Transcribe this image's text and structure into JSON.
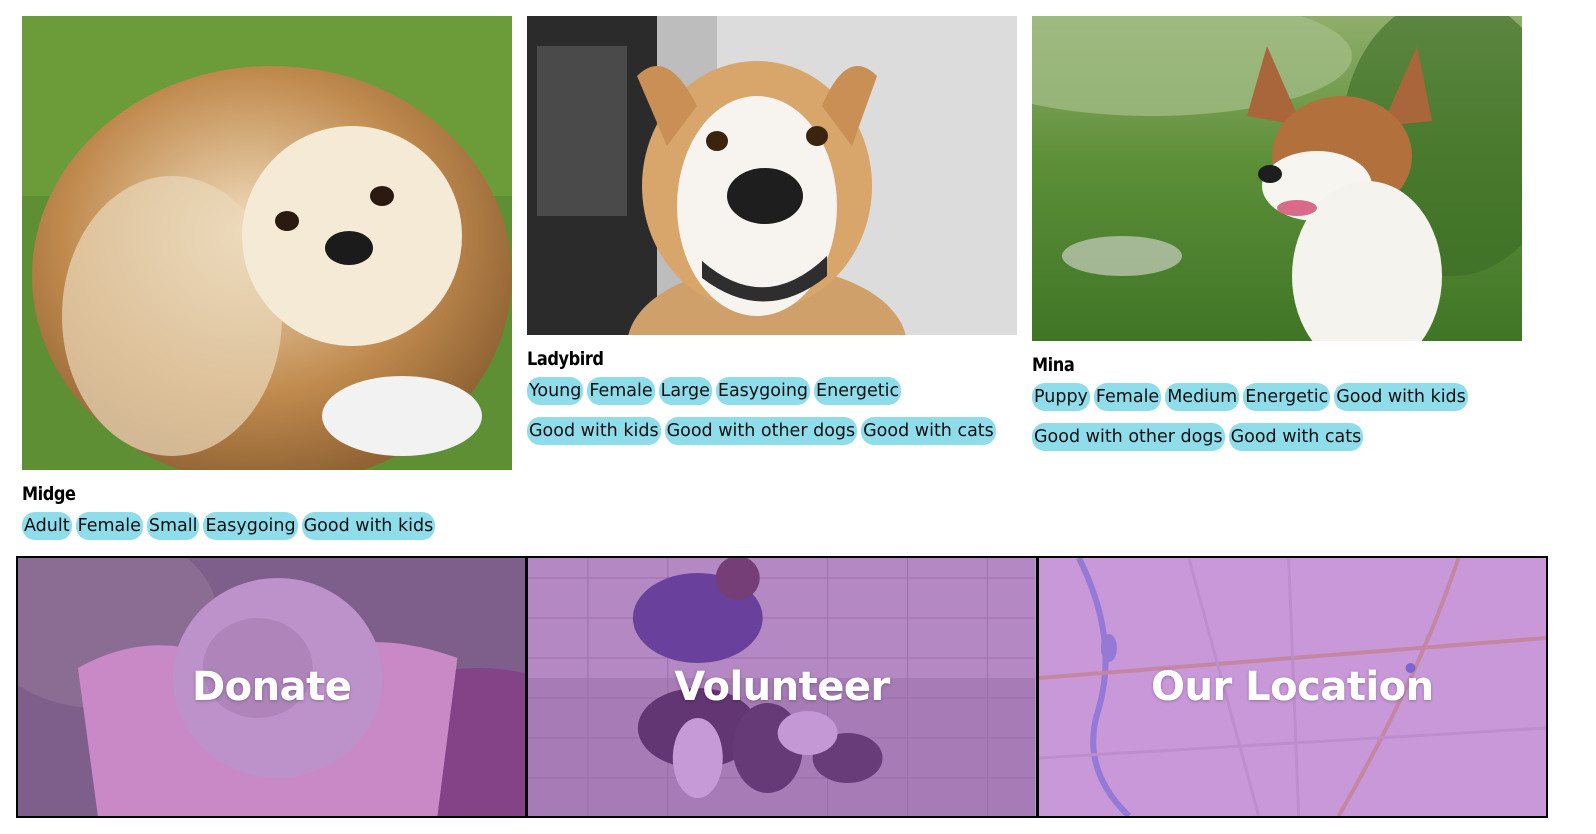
{
  "pets": [
    {
      "name": "Midge",
      "tags": [
        "Adult",
        "Female",
        "Small",
        "Easygoing",
        "Good with kids"
      ]
    },
    {
      "name": "Ladybird",
      "tags": [
        "Young",
        "Female",
        "Large",
        "Easygoing",
        "Energetic",
        "Good with kids",
        "Good with other dogs",
        "Good with cats"
      ]
    },
    {
      "name": "Mina",
      "tags": [
        "Puppy",
        "Female",
        "Medium",
        "Energetic",
        "Good with kids",
        "Good with other dogs",
        "Good with cats"
      ]
    }
  ],
  "actions": [
    {
      "label": "Donate"
    },
    {
      "label": "Volunteer"
    },
    {
      "label": "Our Location"
    }
  ],
  "colors": {
    "tag_bg": "#8fdcea",
    "overlay": "#a654c4"
  }
}
